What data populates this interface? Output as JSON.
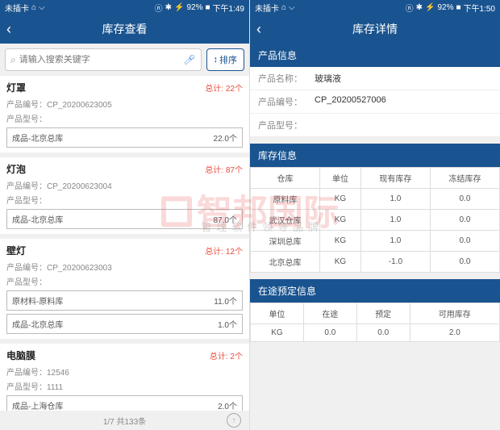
{
  "watermark": {
    "main": "智邦国际",
    "sub": "管理软件领导品牌"
  },
  "left": {
    "status": {
      "carrier": "未插卡",
      "battery": "92%",
      "time": "下午1:49"
    },
    "title": "库存查看",
    "search": {
      "placeholder": "请输入搜索关键字"
    },
    "sort_label": "排序",
    "items": [
      {
        "name": "灯罩",
        "total": "总计: 22个",
        "code_label": "产品编号：",
        "code": "CP_20200623005",
        "model_label": "产品型号：",
        "model": "",
        "stocks": [
          {
            "warehouse": "成品-北京总库",
            "qty": "22.0个"
          }
        ]
      },
      {
        "name": "灯泡",
        "total": "总计: 87个",
        "code_label": "产品编号：",
        "code": "CP_20200623004",
        "model_label": "产品型号：",
        "model": "",
        "stocks": [
          {
            "warehouse": "成品-北京总库",
            "qty": "87.0个"
          }
        ]
      },
      {
        "name": "壁灯",
        "total": "总计: 12个",
        "code_label": "产品编号：",
        "code": "CP_20200623003",
        "model_label": "产品型号：",
        "model": "",
        "stocks": [
          {
            "warehouse": "原材料-原料库",
            "qty": "11.0个"
          },
          {
            "warehouse": "成品-北京总库",
            "qty": "1.0个"
          }
        ]
      },
      {
        "name": "电脑膜",
        "total": "总计: 2个",
        "code_label": "产品编号：",
        "code": "12546",
        "model_label": "产品型号：",
        "model": "1111",
        "stocks": [
          {
            "warehouse": "成品-上海仓库",
            "qty": "2.0个"
          }
        ]
      }
    ],
    "pager": "1/7 共133条"
  },
  "right": {
    "status": {
      "carrier": "未插卡",
      "battery": "92%",
      "time": "下午1:50"
    },
    "title": "库存详情",
    "product_info": {
      "section": "产品信息",
      "name_label": "产品名称：",
      "name": "玻璃液",
      "code_label": "产品编号：",
      "code": "CP_20200527006",
      "model_label": "产品型号：",
      "model": ""
    },
    "stock_info": {
      "section": "库存信息",
      "headers": [
        "仓库",
        "单位",
        "现有库存",
        "冻结库存"
      ],
      "rows": [
        [
          "原料库",
          "KG",
          "1.0",
          "0.0"
        ],
        [
          "武汉仓库",
          "KG",
          "1.0",
          "0.0"
        ],
        [
          "深圳总库",
          "KG",
          "1.0",
          "0.0"
        ],
        [
          "北京总库",
          "KG",
          "-1.0",
          "0.0"
        ]
      ]
    },
    "transit_info": {
      "section": "在途预定信息",
      "headers": [
        "单位",
        "在途",
        "预定",
        "可用库存"
      ],
      "rows": [
        [
          "KG",
          "0.0",
          "0.0",
          "2.0"
        ]
      ]
    }
  }
}
